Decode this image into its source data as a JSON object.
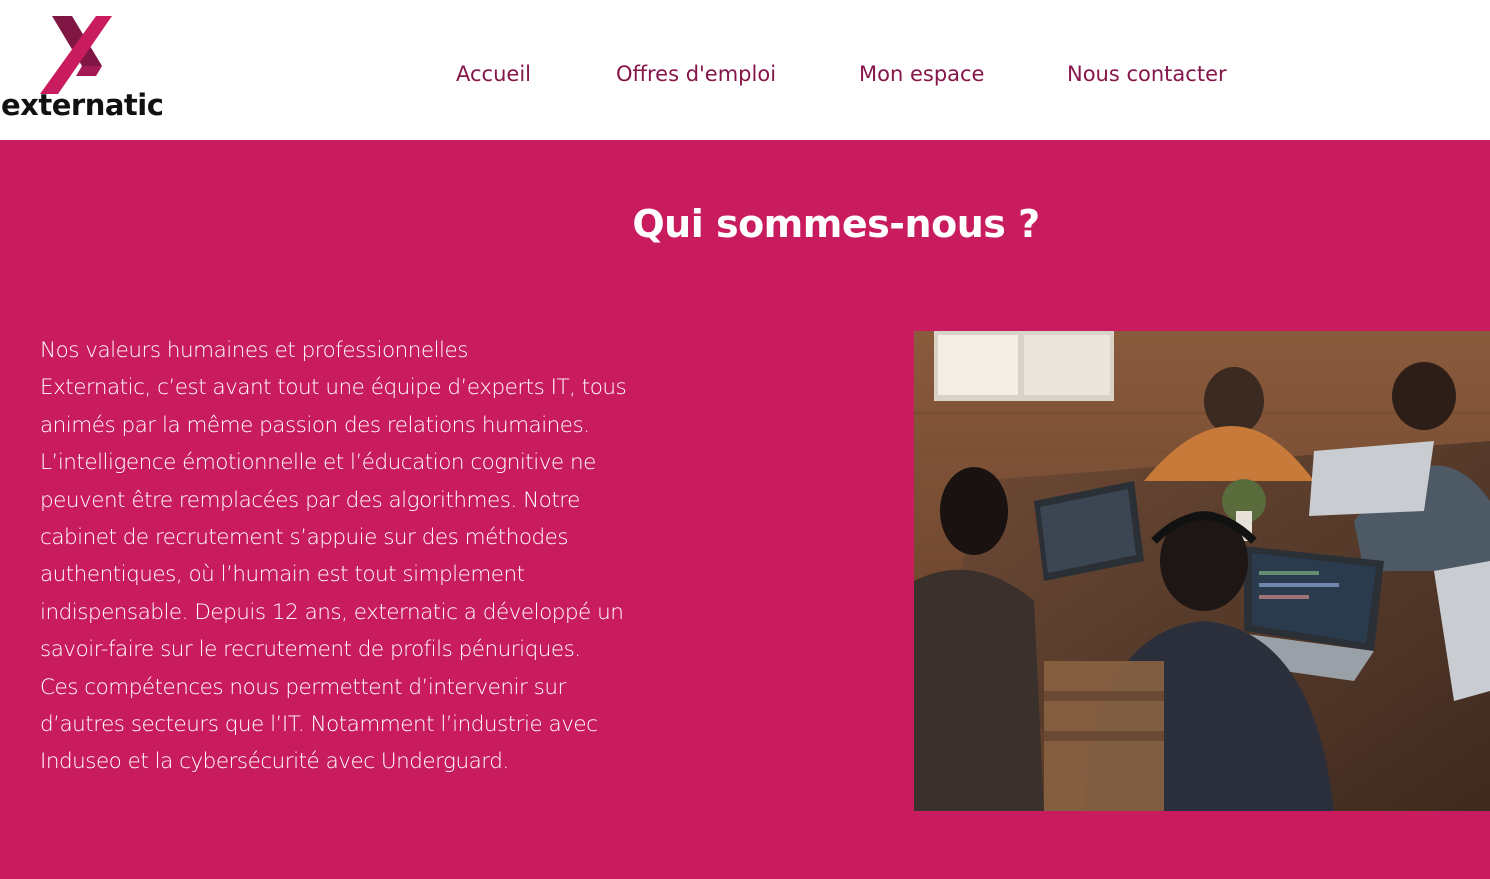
{
  "brand": {
    "name": "externatic",
    "primary_color": "#c91c5e",
    "nav_color": "#86164a",
    "logo_mark_color": "#a31a55"
  },
  "nav": {
    "items": [
      {
        "label": "Accueil"
      },
      {
        "label": "Offres d'emploi"
      },
      {
        "label": "Mon espace"
      },
      {
        "label": "Nous contacter"
      }
    ]
  },
  "hero": {
    "title": "Qui sommes-nous ?",
    "paragraph_lines": [
      "Nos valeurs humaines et professionnelles",
      "Externatic, c’est avant tout une équipe d’experts IT, tous",
      "animés par la même passion des relations humaines.",
      "L’intelligence émotionnelle et l’éducation cognitive ne",
      "peuvent être remplacées par des algorithmes. Notre",
      "cabinet de recrutement s’appuie sur des méthodes",
      "authentiques, où l’humain est tout simplement",
      "indispensable. Depuis 12 ans, externatic a développé un",
      "savoir-faire sur le recrutement de profils pénuriques.",
      "Ces compétences nous permettent d’intervenir sur",
      "d’autres secteurs que l’IT. Notamment l’industrie avec",
      "Induseo et la cybersécurité avec Underguard."
    ]
  }
}
